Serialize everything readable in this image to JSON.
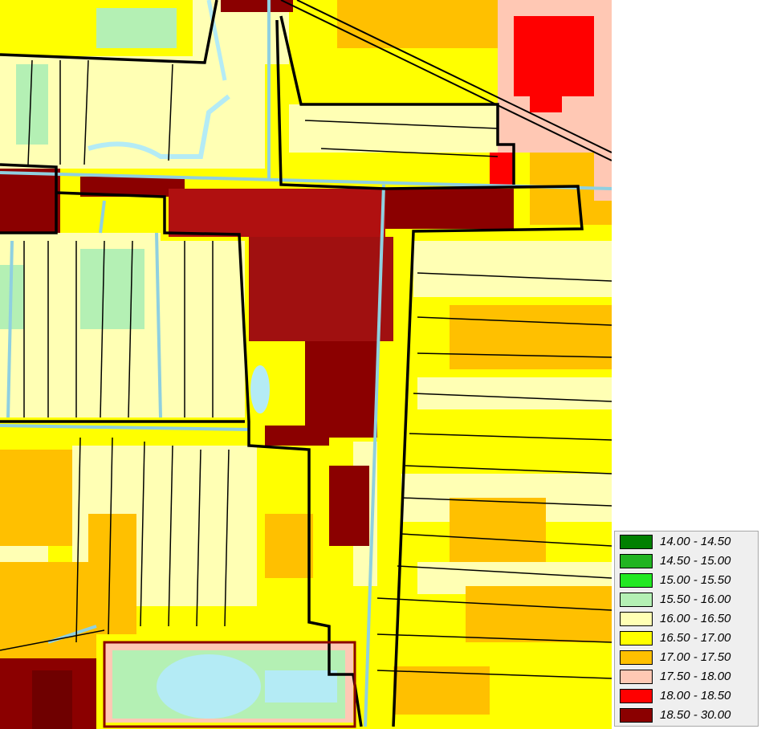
{
  "map": {
    "colors": {
      "background_field": "#ffff00",
      "pale_field": "#ffffb4",
      "warm_field": "#ffc000",
      "built_up": "#8b0000",
      "hot": "#ff0000",
      "salmon": "#ffc8b4",
      "water": "#b4ebf5",
      "cool_green": "#b4f0b4",
      "boundary": "#000000"
    }
  },
  "legend": {
    "classes": [
      {
        "label": "14.00 - 14.50",
        "color": "#008000"
      },
      {
        "label": "14.50 - 15.00",
        "color": "#22b422"
      },
      {
        "label": "15.00 - 15.50",
        "color": "#22e822"
      },
      {
        "label": "15.50 - 16.00",
        "color": "#b4f0b4"
      },
      {
        "label": "16.00 - 16.50",
        "color": "#ffffb4"
      },
      {
        "label": "16.50 - 17.00",
        "color": "#ffff00"
      },
      {
        "label": "17.00 - 17.50",
        "color": "#ffc000"
      },
      {
        "label": "17.50 - 18.00",
        "color": "#ffc8b4"
      },
      {
        "label": "18.00 - 18.50",
        "color": "#ff0000"
      },
      {
        "label": "18.50 - 30.00",
        "color": "#8b0000"
      }
    ]
  }
}
